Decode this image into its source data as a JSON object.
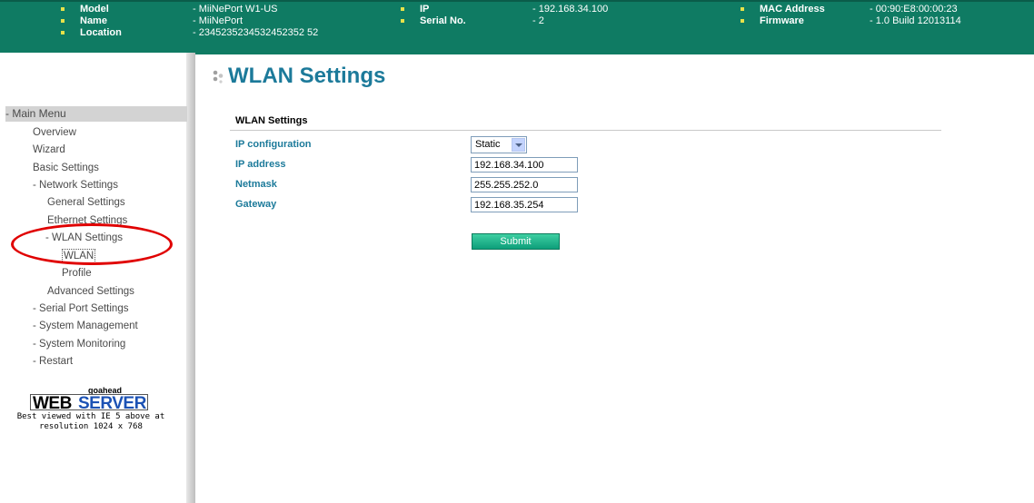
{
  "header": {
    "model": {
      "label": "Model",
      "value": "- MiiNePort W1-US"
    },
    "name": {
      "label": "Name",
      "value": "- MiiNePort"
    },
    "location": {
      "label": "Location",
      "value": "- 2345235234532452352 52"
    },
    "ip": {
      "label": "IP",
      "value": "- 192.168.34.100"
    },
    "serial": {
      "label": "Serial No.",
      "value": "- 2"
    },
    "mac": {
      "label": "MAC Address",
      "value": "- 00:90:E8:00:00:23"
    },
    "firmware": {
      "label": "Firmware",
      "value": "- 1.0 Build 12013114"
    }
  },
  "sidebar": {
    "menu_title": "- Main Menu",
    "items": [
      {
        "label": "Overview"
      },
      {
        "label": "Wizard"
      },
      {
        "label": "Basic Settings"
      },
      {
        "label": "- Network Settings"
      },
      {
        "label": "General Settings"
      },
      {
        "label": "Ethernet Settings"
      },
      {
        "label": "- WLAN Settings"
      },
      {
        "label": "WLAN"
      },
      {
        "label": "Profile"
      },
      {
        "label": "Advanced Settings"
      },
      {
        "label": "- Serial Port Settings"
      },
      {
        "label": "- System Management"
      },
      {
        "label": "- System Monitoring"
      },
      {
        "label": "- Restart"
      }
    ],
    "logo": {
      "top": "goahead",
      "web": "WEB",
      "server": "SERVER"
    },
    "best_viewed_line1": "Best viewed with IE 5 above at",
    "best_viewed_line2": "resolution 1024 x 768"
  },
  "main": {
    "page_title": "WLAN Settings",
    "section_title": "WLAN Settings",
    "fields": {
      "ip_configuration": {
        "label": "IP configuration",
        "value": "Static"
      },
      "ip_address": {
        "label": "IP address",
        "value": "192.168.34.100"
      },
      "netmask": {
        "label": "Netmask",
        "value": "255.255.252.0"
      },
      "gateway": {
        "label": "Gateway",
        "value": "192.168.35.254"
      }
    },
    "submit_label": "Submit"
  },
  "colors": {
    "header_bg": "#0f7b63",
    "accent_text": "#1c7a9a",
    "submit_bg": "#16b088",
    "highlight_circle": "#e00000"
  }
}
